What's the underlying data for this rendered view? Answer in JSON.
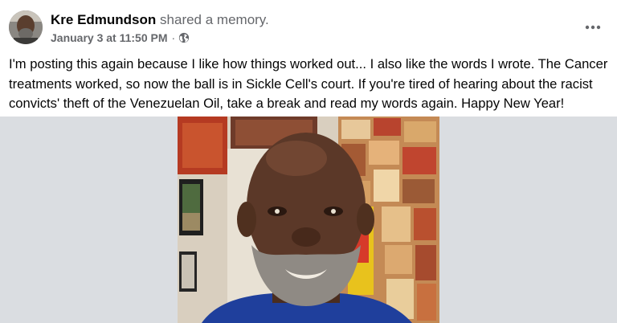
{
  "post": {
    "author_name": "Kre Edmundson",
    "action_text": "shared a memory.",
    "timestamp": "January 3 at 11:50 PM",
    "separator": "·",
    "privacy_icon": "globe-icon",
    "more_icon": "more-options-icon",
    "body_text": "I'm posting this again because I like how things worked out... I also like the words I wrote. The Cancer treatments worked, so now the ball is in Sickle Cell's court. If you're tired of hearing about the racist convicts' theft of the Venezuelan Oil, take a break and read my words again. Happy New Year!"
  },
  "photo": {
    "description_icon": "selfie-photo"
  },
  "colors": {
    "text_primary": "#050505",
    "text_secondary": "#65676b",
    "media_background": "#dadde1"
  }
}
